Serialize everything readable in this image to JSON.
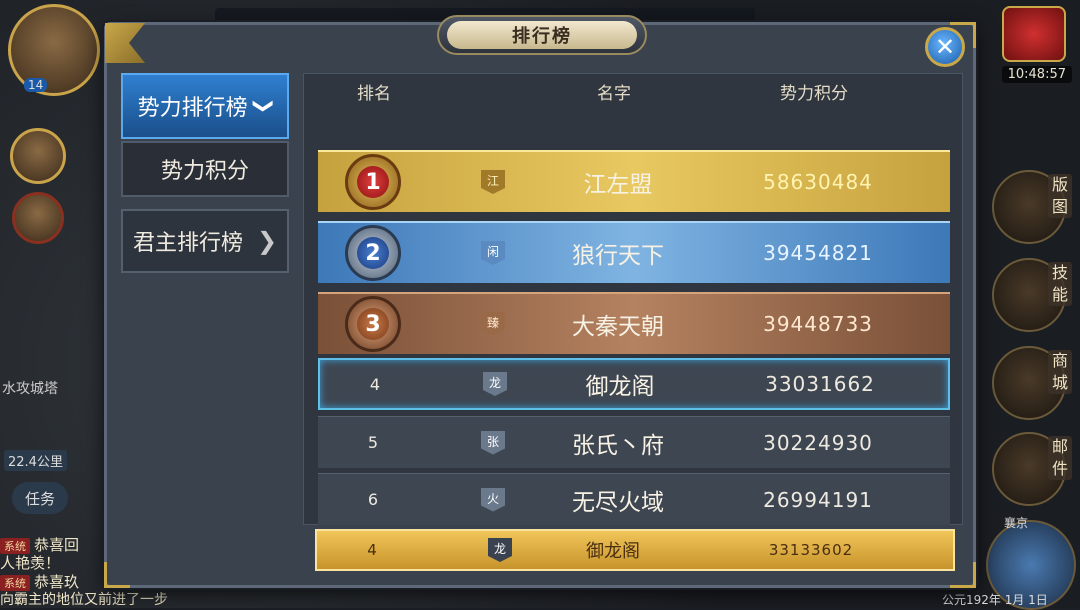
{
  "panel": {
    "title": "排行榜",
    "close_label": "✕"
  },
  "tabs": {
    "main": {
      "label": "势力排行榜",
      "chevron": "❯"
    },
    "sub": {
      "label": "势力积分"
    },
    "other": {
      "label": "君主排行榜",
      "chevron": "❯"
    }
  },
  "table": {
    "headers": {
      "rank": "排名",
      "name": "名字",
      "score": "势力积分"
    },
    "rows": [
      {
        "rank": "1",
        "flag": "江",
        "name": "江左盟",
        "score": "58630484"
      },
      {
        "rank": "2",
        "flag": "闲",
        "name": "狼行天下",
        "score": "39454821"
      },
      {
        "rank": "3",
        "flag": "臻",
        "name": "大秦天朝",
        "score": "39448733"
      },
      {
        "rank": "4",
        "flag": "龙",
        "name": "御龙阁",
        "score": "33031662"
      },
      {
        "rank": "5",
        "flag": "张",
        "name": "张氏丶府",
        "score": "30224930"
      },
      {
        "rank": "6",
        "flag": "火",
        "name": "无尽火域",
        "score": "26994191"
      }
    ],
    "self": {
      "rank": "4",
      "flag": "龙",
      "name": "御龙阁",
      "score": "33133602"
    }
  },
  "hud": {
    "level": "14",
    "clock": "10:48:57",
    "city_label": "水攻城塔",
    "distance": "22.4公里",
    "task_label": "任务",
    "right_labels": [
      "版图",
      "技能",
      "商城",
      "邮件"
    ],
    "capital": "襄京",
    "date": "公元192年 1月 1日"
  },
  "chat": [
    {
      "tag": "系统",
      "text": "恭喜回"
    },
    {
      "tag": "",
      "text": "人艳羡！"
    },
    {
      "tag": "系统",
      "text": "恭喜玖"
    },
    {
      "tag": "",
      "text": "向霸主的地位又前进了一步"
    }
  ],
  "colors": {
    "gold": "#c9a84a",
    "blue_tab": "#2f7fd0",
    "panel": "#3a424e"
  }
}
